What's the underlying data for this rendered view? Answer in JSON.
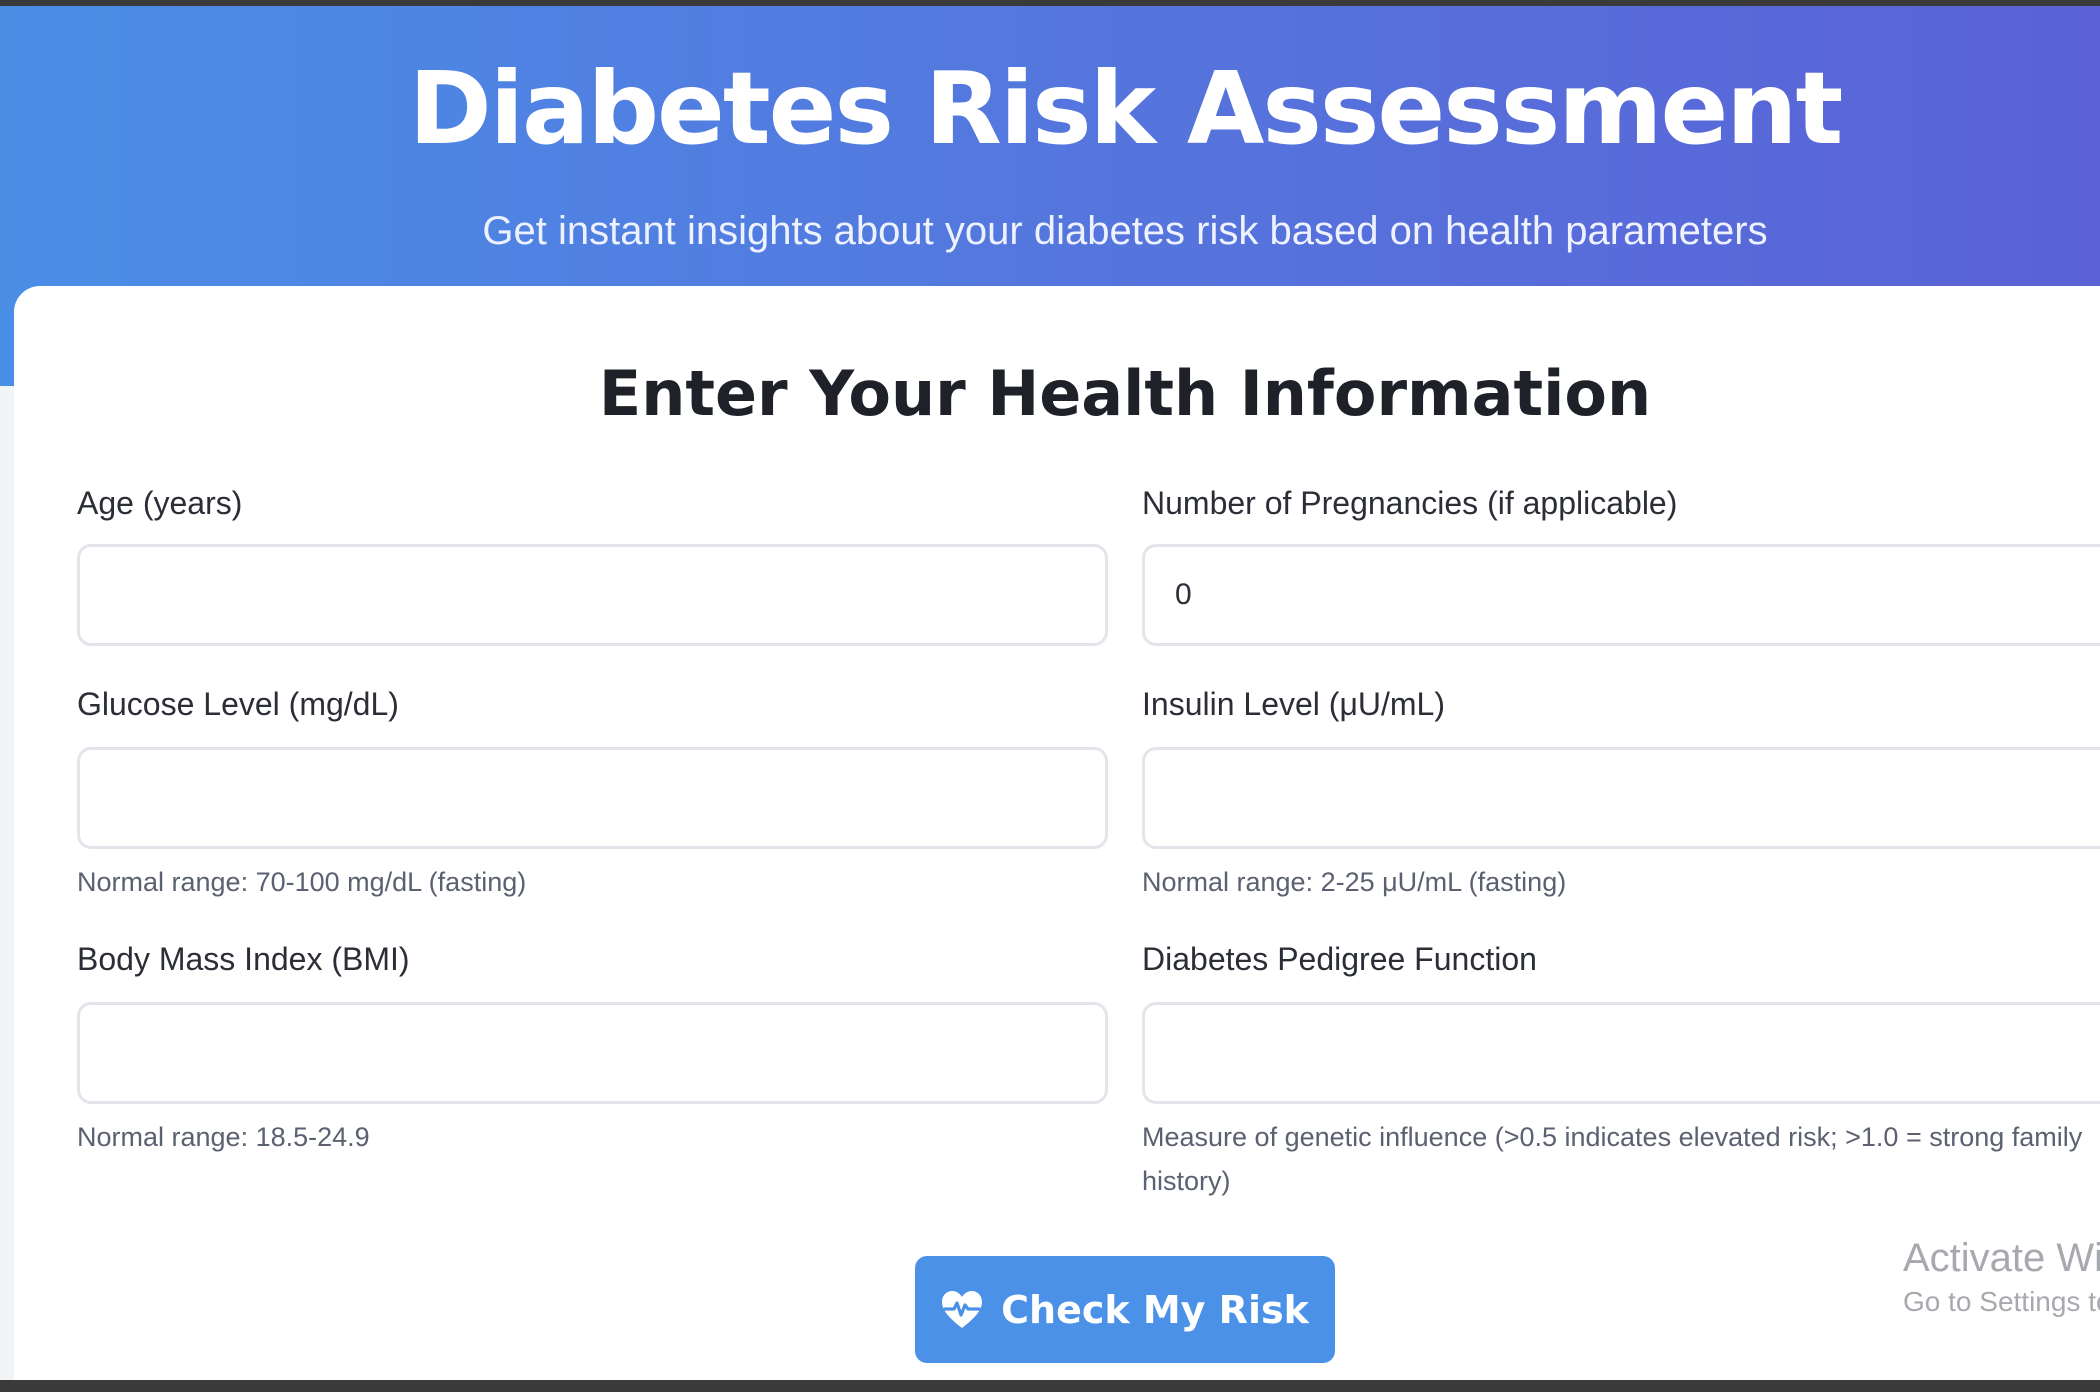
{
  "header": {
    "title": "Diabetes Risk Assessment",
    "subtitle": "Get instant insights about your diabetes risk based on health parameters"
  },
  "form": {
    "title": "Enter Your Health Information",
    "fields": {
      "age": {
        "label": "Age (years)",
        "value": ""
      },
      "pregnancies": {
        "label": "Number of Pregnancies (if applicable)",
        "value": "0"
      },
      "glucose": {
        "label": "Glucose Level (mg/dL)",
        "value": "",
        "hint": "Normal range: 70-100 mg/dL (fasting)"
      },
      "insulin": {
        "label": "Insulin Level (μU/mL)",
        "value": "",
        "hint": "Normal range: 2-25 μU/mL (fasting)"
      },
      "bmi": {
        "label": "Body Mass Index (BMI)",
        "value": "",
        "hint": "Normal range: 18.5-24.9"
      },
      "pedigree": {
        "label": "Diabetes Pedigree Function",
        "value": "",
        "hint": "Measure of genetic influence (>0.5 indicates elevated risk; >1.0 = strong family history)"
      }
    },
    "submit_label": "Check My Risk",
    "submit_icon": "heart-pulse-icon"
  },
  "watermark": {
    "title": "Activate Windows",
    "subtitle": "Go to Settings to activate Windows."
  },
  "colors": {
    "header_gradient_start": "#4a8ee6",
    "header_gradient_end": "#5a62d6",
    "button": "#4b91e8"
  }
}
